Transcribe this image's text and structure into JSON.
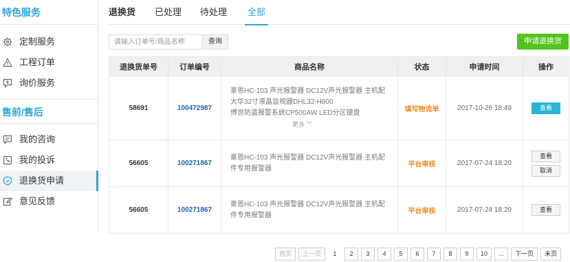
{
  "sidebar": {
    "section1_title": "特色服务",
    "section1_items": [
      {
        "label": "定制服务",
        "icon": "gear-icon"
      },
      {
        "label": "工程订单",
        "icon": "warning-triangle-icon"
      },
      {
        "label": "询价服务",
        "icon": "chat-dollar-icon"
      }
    ],
    "section2_title": "售前/售后",
    "section2_items": [
      {
        "label": "我的咨询",
        "icon": "message-icon"
      },
      {
        "label": "我的投诉",
        "icon": "phone-complaint-icon"
      },
      {
        "label": "退换货申请",
        "icon": "shield-icon"
      },
      {
        "label": "意见反馈",
        "icon": "edit-icon"
      }
    ]
  },
  "tabs": [
    "退换货",
    "已处理",
    "待处理",
    "全部"
  ],
  "search": {
    "placeholder": "请输入订单号/商品名称",
    "button": "查询"
  },
  "apply_button": "申请退换货",
  "table": {
    "headers": [
      "退换货单号",
      "订单编号",
      "商品名称",
      "状态",
      "申请时间",
      "操作"
    ],
    "rows": [
      {
        "return_id": "58691",
        "order_id": "100472987",
        "product_lines": [
          "豪恩HC-103 声光报警器 DC12V声光报警器 主机配",
          "大华32寸液晶监视器DHL32-H800",
          "博世防盗报警系统CP500AW LED分区键盘"
        ],
        "more": "更多",
        "status": "填写物流单",
        "time": "2017-10-26 18:49",
        "actions": [
          "查看"
        ]
      },
      {
        "return_id": "56605",
        "order_id": "100271867",
        "product_lines": [
          "豪恩HC-103 声光报警器 DC12V声光报警器 主机配",
          "件专用报警器"
        ],
        "status": "平台审核",
        "time": "2017-07-24 18:20",
        "actions": [
          "查看",
          "取消"
        ]
      },
      {
        "return_id": "56605",
        "order_id": "100271867",
        "product_lines": [
          "豪恩HC-103 声光报警器 DC12V声光报警器 主机配",
          "件专用报警器"
        ],
        "status": "平台审核",
        "time": "2017-07-24 18:20",
        "actions": [
          "查看"
        ]
      }
    ]
  },
  "pagination": {
    "first": "首页",
    "prev": "上一页",
    "pages": [
      "1",
      "2",
      "3",
      "4",
      "5",
      "6",
      "7",
      "8",
      "9",
      "10"
    ],
    "ellipsis": "...",
    "next": "下一页",
    "last": "末页",
    "current": "1"
  },
  "colors": {
    "accent": "#2aa7d6",
    "apply_button": "#52c41a",
    "status": "#f08c1e",
    "order_link": "#1f5fb0"
  }
}
